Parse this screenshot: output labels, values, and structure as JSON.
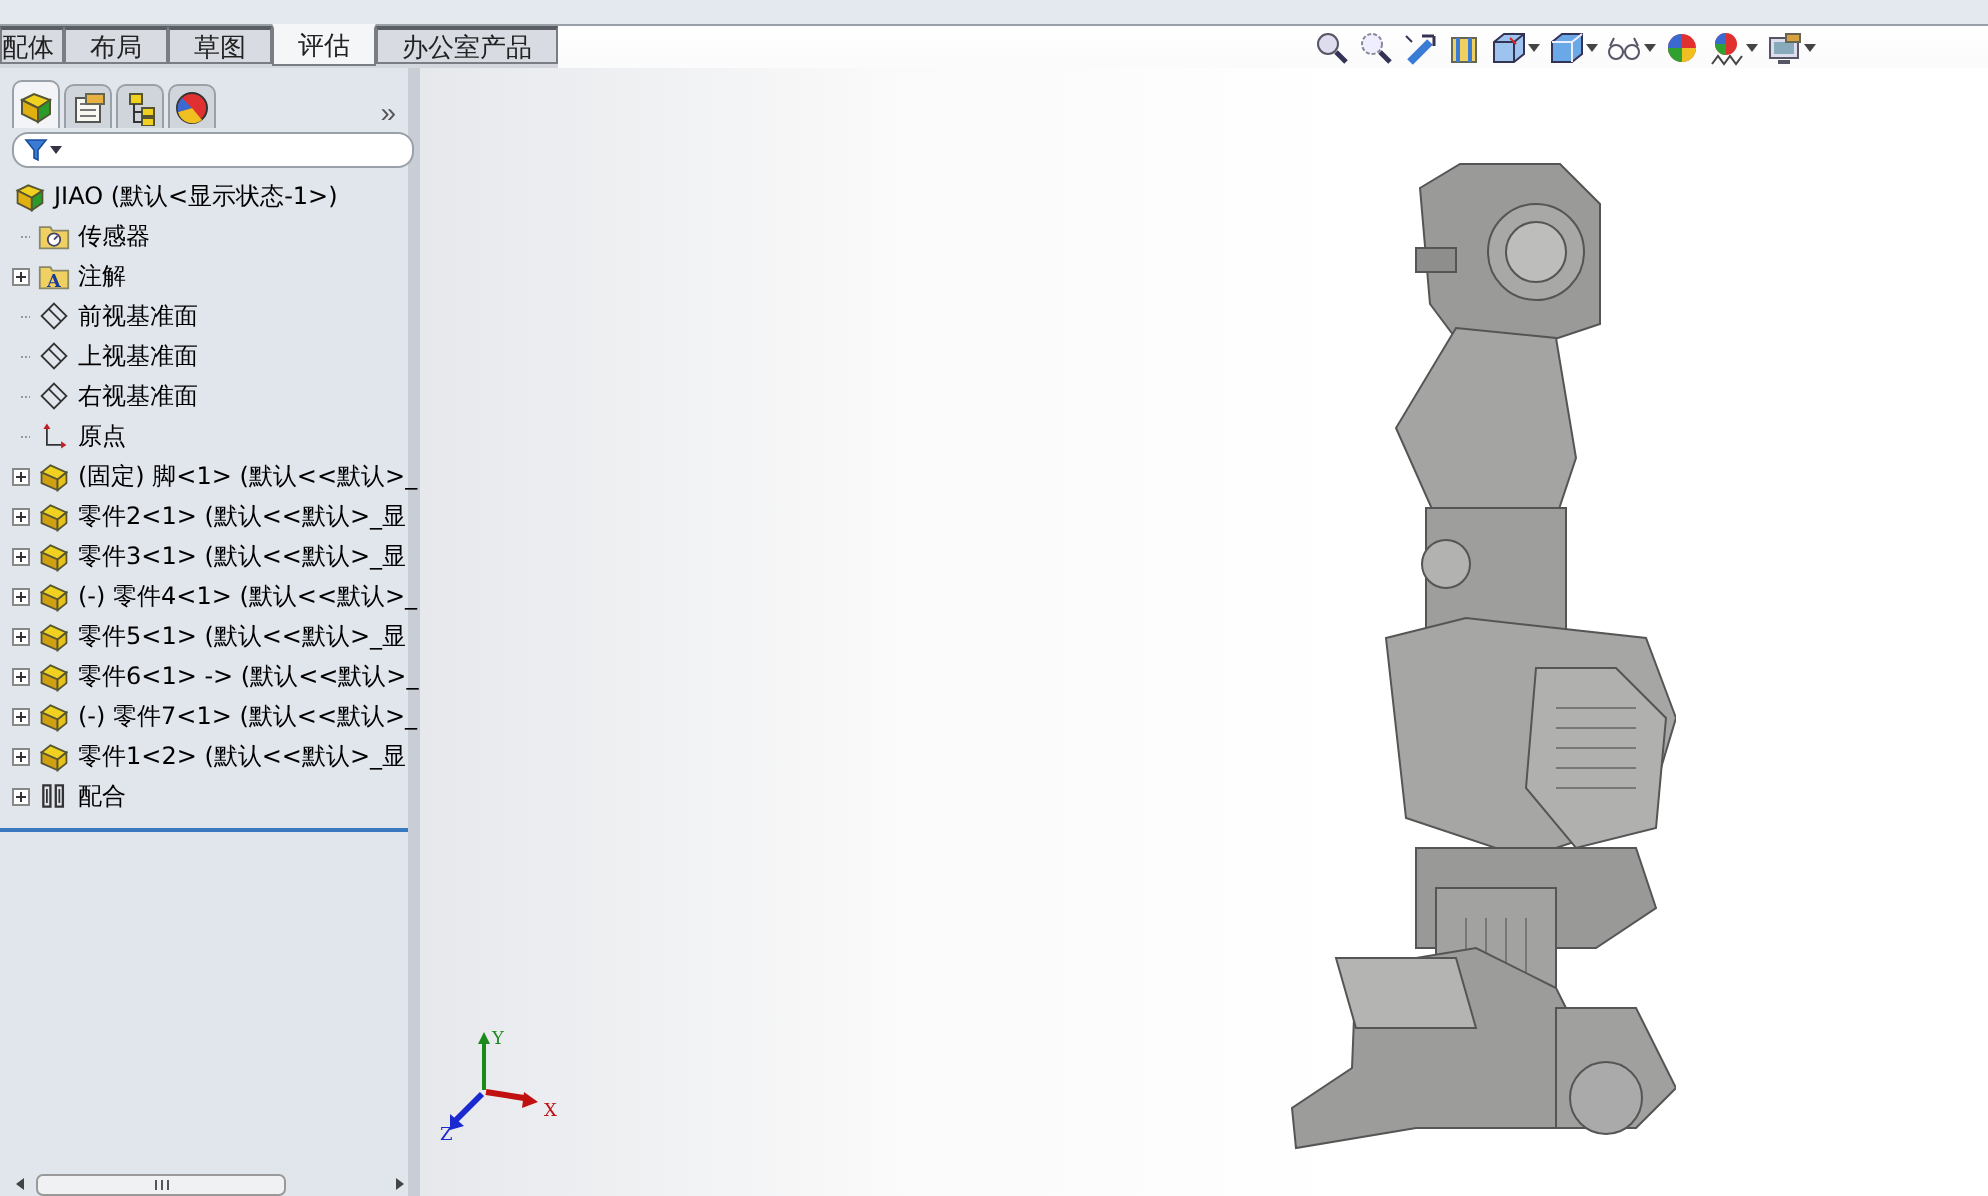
{
  "command_tabs": [
    {
      "label": "配体",
      "selected": false
    },
    {
      "label": "布局",
      "selected": false
    },
    {
      "label": "草图",
      "selected": false
    },
    {
      "label": "评估",
      "selected": true
    },
    {
      "label": "办公室产品",
      "selected": false
    }
  ],
  "panel_tabs": [
    {
      "kind": "feature-tree",
      "selected": true
    },
    {
      "kind": "property",
      "selected": false
    },
    {
      "kind": "configuration",
      "selected": false
    },
    {
      "kind": "display",
      "selected": false
    }
  ],
  "panel_expand": "»",
  "tree": {
    "label": "JIAO  (默认<显示状态-1>)",
    "kind": "assembly",
    "children": [
      {
        "label": "传感器",
        "kind": "sensor",
        "collapsed": false
      },
      {
        "label": "注解",
        "kind": "annotation",
        "collapsed": true,
        "icon_letter": "A"
      },
      {
        "label": "前视基准面",
        "kind": "plane",
        "collapsed": false
      },
      {
        "label": "上视基准面",
        "kind": "plane",
        "collapsed": false
      },
      {
        "label": "右视基准面",
        "kind": "plane",
        "collapsed": false
      },
      {
        "label": "原点",
        "kind": "origin",
        "collapsed": false
      },
      {
        "label": "(固定) 脚<1> (默认<<默认>_",
        "kind": "part",
        "collapsed": true
      },
      {
        "label": "零件2<1> (默认<<默认>_显",
        "kind": "part",
        "collapsed": true
      },
      {
        "label": "零件3<1> (默认<<默认>_显",
        "kind": "part",
        "collapsed": true
      },
      {
        "label": "(-) 零件4<1> (默认<<默认>_",
        "kind": "part",
        "collapsed": true
      },
      {
        "label": "零件5<1> (默认<<默认>_显",
        "kind": "part",
        "collapsed": true
      },
      {
        "label": "零件6<1> -> (默认<<默认>_",
        "kind": "part",
        "collapsed": true
      },
      {
        "label": "(-) 零件7<1> (默认<<默认>_",
        "kind": "part",
        "collapsed": true
      },
      {
        "label": "零件1<2> (默认<<默认>_显",
        "kind": "part",
        "collapsed": true
      },
      {
        "label": "配合",
        "kind": "mates",
        "collapsed": true
      }
    ]
  },
  "triad": {
    "x": "X",
    "y": "Y",
    "z": "Z"
  }
}
